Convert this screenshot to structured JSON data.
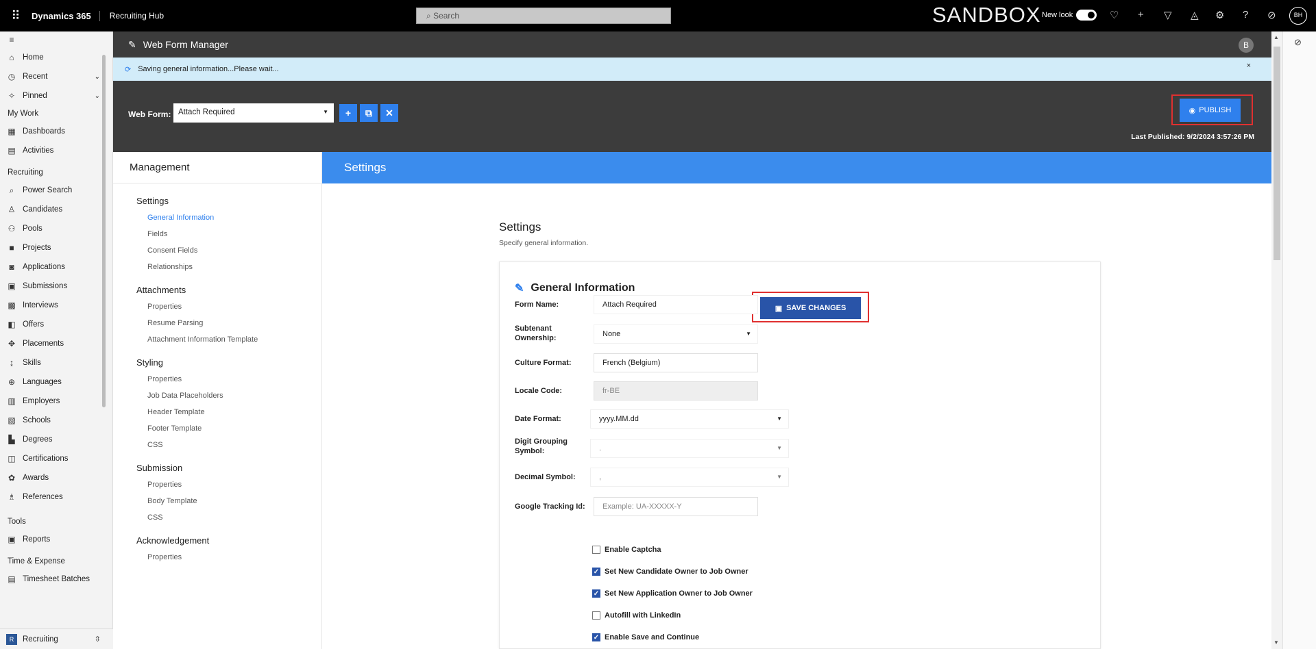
{
  "topbar": {
    "app_name": "Dynamics 365",
    "hub_name": "Recruiting Hub",
    "search_placeholder": "Search",
    "environment": "SANDBOX",
    "new_look_label": "New look",
    "avatar_initials": "BH"
  },
  "leftnav": {
    "top_items": [
      {
        "label": "Home",
        "icon": "home-icon"
      },
      {
        "label": "Recent",
        "icon": "clock-icon"
      },
      {
        "label": "Pinned",
        "icon": "pin-icon"
      }
    ],
    "my_work_label": "My Work",
    "my_work_items": [
      {
        "label": "Dashboards"
      },
      {
        "label": "Activities"
      }
    ],
    "recruiting_label": "Recruiting",
    "recruiting_items": [
      {
        "label": "Power Search"
      },
      {
        "label": "Candidates"
      },
      {
        "label": "Pools"
      },
      {
        "label": "Projects"
      },
      {
        "label": "Applications"
      },
      {
        "label": "Submissions"
      },
      {
        "label": "Interviews"
      },
      {
        "label": "Offers"
      },
      {
        "label": "Placements"
      },
      {
        "label": "Skills"
      },
      {
        "label": "Languages"
      },
      {
        "label": "Employers"
      },
      {
        "label": "Schools"
      },
      {
        "label": "Degrees"
      },
      {
        "label": "Certifications"
      },
      {
        "label": "Awards"
      },
      {
        "label": "References"
      }
    ],
    "tools_label": "Tools",
    "tools_items": [
      {
        "label": "Reports"
      }
    ],
    "time_label": "Time & Expense",
    "time_items": [
      {
        "label": "Timesheet Batches"
      }
    ],
    "area_badge": "R",
    "area_label": "Recruiting"
  },
  "header": {
    "title": "Web Form Manager",
    "user_initial": "B"
  },
  "notification": {
    "message": "Saving general information...Please wait...",
    "close": "×"
  },
  "toolbar": {
    "web_form_label": "Web Form:",
    "web_form_value": "Attach Required",
    "add_symbol": "+",
    "copy_symbol": "⧉",
    "delete_symbol": "✕",
    "publish_label": "PUBLISH",
    "last_published": "Last Published: 9/2/2024 3:57:26 PM"
  },
  "management": {
    "title": "Management",
    "groups": [
      {
        "label": "Settings",
        "links": [
          "General Information",
          "Fields",
          "Consent Fields",
          "Relationships"
        ]
      },
      {
        "label": "Attachments",
        "links": [
          "Properties",
          "Resume Parsing",
          "Attachment Information Template"
        ]
      },
      {
        "label": "Styling",
        "links": [
          "Properties",
          "Job Data Placeholders",
          "Header Template",
          "Footer Template",
          "CSS"
        ]
      },
      {
        "label": "Submission",
        "links": [
          "Properties",
          "Body Template",
          "CSS"
        ]
      },
      {
        "label": "Acknowledgement",
        "links": [
          "Properties"
        ]
      }
    ],
    "active_link": "General Information"
  },
  "settings": {
    "bar_title": "Settings",
    "heading": "Settings",
    "subheading": "Specify general information."
  },
  "general_info": {
    "title": "General Information",
    "save_label": "SAVE CHANGES",
    "form_name_label": "Form Name:",
    "form_name_value": "Attach Required",
    "subtenant_label": "Subtenant Ownership:",
    "subtenant_value": "None",
    "culture_label": "Culture Format:",
    "culture_value": "French (Belgium)",
    "locale_label": "Locale Code:",
    "locale_value": "fr-BE",
    "date_label": "Date Format:",
    "date_value": "yyyy.MM.dd",
    "digit_label": "Digit Grouping Symbol:",
    "digit_value": ".",
    "decimal_label": "Decimal Symbol:",
    "decimal_value": ",",
    "tracking_label": "Google Tracking Id:",
    "tracking_placeholder": "Example: UA-XXXXX-Y",
    "checkboxes": [
      {
        "label": "Enable Captcha",
        "checked": false
      },
      {
        "label": "Set New Candidate Owner to Job Owner",
        "checked": true
      },
      {
        "label": "Set New Application Owner to Job Owner",
        "checked": true
      },
      {
        "label": "Autofill with LinkedIn",
        "checked": false
      },
      {
        "label": "Enable Save and Continue",
        "checked": true
      }
    ]
  }
}
